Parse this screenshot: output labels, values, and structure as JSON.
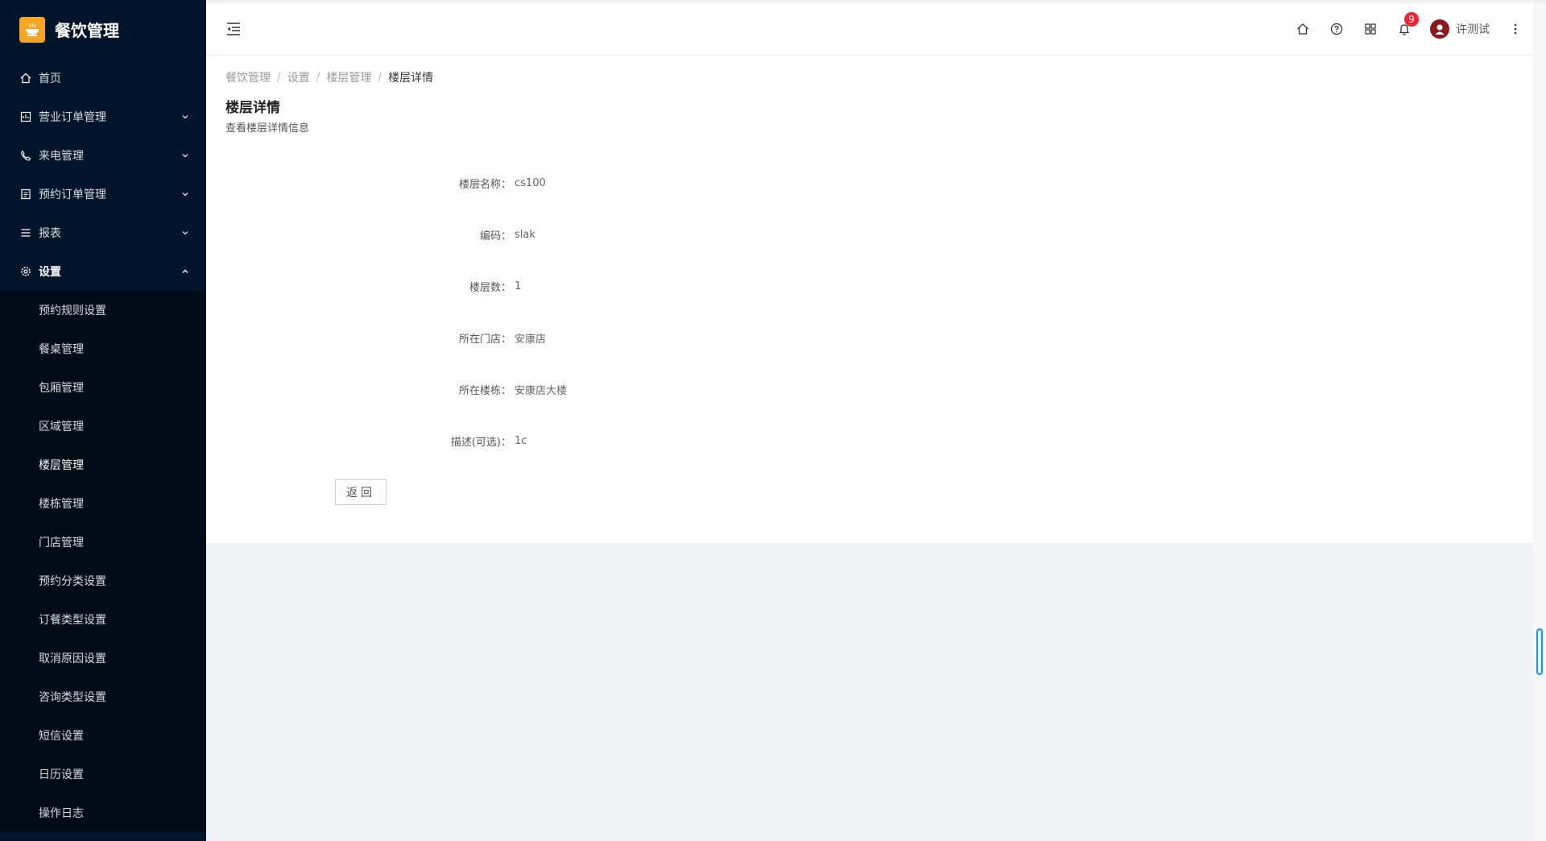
{
  "app": {
    "title": "餐饮管理"
  },
  "sidebar": {
    "items": [
      {
        "label": "首页",
        "icon": "home-icon"
      },
      {
        "label": "营业订单管理",
        "icon": "order-icon"
      },
      {
        "label": "来电管理",
        "icon": "phone-icon"
      },
      {
        "label": "预约订单管理",
        "icon": "reservation-icon"
      },
      {
        "label": "报表",
        "icon": "report-icon"
      },
      {
        "label": "设置",
        "icon": "gear-icon"
      }
    ],
    "settings_sub": [
      "预约规则设置",
      "餐桌管理",
      "包厢管理",
      "区域管理",
      "楼层管理",
      "楼栋管理",
      "门店管理",
      "预约分类设置",
      "订餐类型设置",
      "取消原因设置",
      "咨询类型设置",
      "短信设置",
      "日历设置",
      "操作日志"
    ]
  },
  "header": {
    "notification_count": "9",
    "user_name": "许测试"
  },
  "breadcrumb": [
    "餐饮管理",
    "设置",
    "楼层管理",
    "楼层详情"
  ],
  "page": {
    "title": "楼层详情",
    "subtitle": "查看楼层详情信息"
  },
  "details": [
    {
      "label": "楼层名称：",
      "value": "cs100"
    },
    {
      "label": "编码：",
      "value": "slak"
    },
    {
      "label": "楼层数：",
      "value": "1"
    },
    {
      "label": "所在门店：",
      "value": "安康店"
    },
    {
      "label": "所在楼栋：",
      "value": "安康店大楼"
    },
    {
      "label": "描述(可选)：",
      "value": "1c"
    }
  ],
  "buttons": {
    "back": "返回"
  },
  "colors": {
    "sidebar_bg": "#001529",
    "submenu_bg": "#000c17",
    "brand_logo": "#f5a623",
    "badge": "#f5222d"
  }
}
